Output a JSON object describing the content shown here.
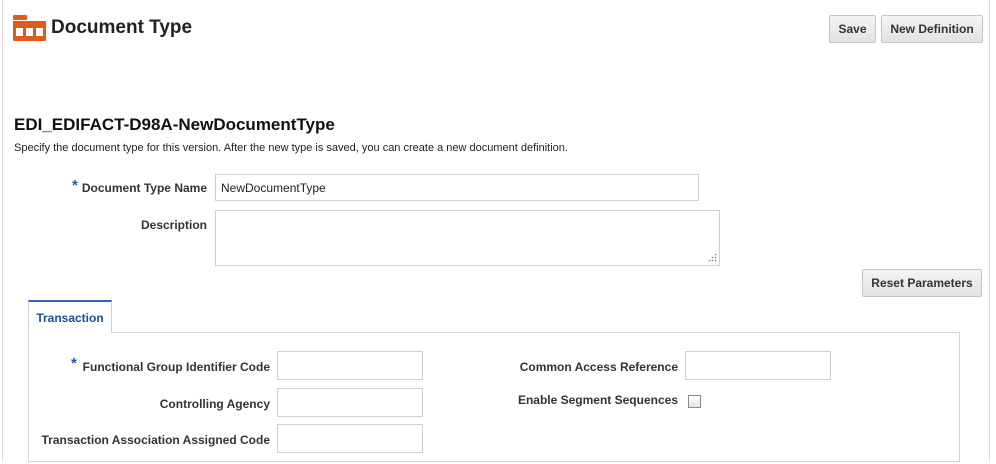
{
  "header": {
    "title": "Document Type",
    "icon": "document-type-icon",
    "accent_color": "#e05a1b",
    "buttons": {
      "save": "Save",
      "new_definition": "New Definition"
    }
  },
  "section": {
    "title": "EDI_EDIFACT-D98A-NewDocumentType",
    "instruction": "Specify the document type for this version. After the new type is saved, you can create a new document definition."
  },
  "form": {
    "required_marker": "*",
    "document_type_name": {
      "label": "Document Type Name",
      "value": "NewDocumentType"
    },
    "description": {
      "label": "Description",
      "value": ""
    }
  },
  "reset_button": "Reset Parameters",
  "tabs": [
    {
      "label": "Transaction",
      "selected": true
    }
  ],
  "transaction": {
    "functional_group_identifier_code": {
      "label": "Functional Group Identifier Code",
      "value": ""
    },
    "controlling_agency": {
      "label": "Controlling Agency",
      "value": ""
    },
    "transaction_association_assigned_code": {
      "label": "Transaction Association Assigned Code",
      "value": ""
    },
    "common_access_reference": {
      "label": "Common Access Reference",
      "value": ""
    },
    "enable_segment_sequences": {
      "label": "Enable Segment Sequences",
      "checked": false
    }
  }
}
